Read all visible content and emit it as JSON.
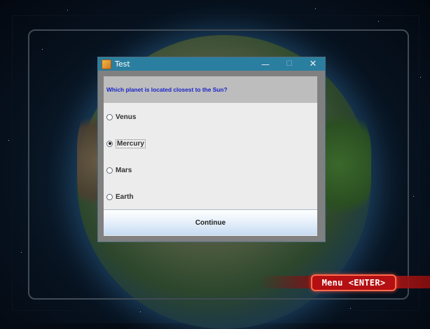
{
  "window": {
    "title": "Test",
    "controls": {
      "minimize": "—",
      "maximize": "☐",
      "close": "✕"
    }
  },
  "quiz": {
    "question": "Which planet is located closest to the Sun?",
    "options": [
      {
        "label": "Venus",
        "selected": false
      },
      {
        "label": "Mercury",
        "selected": true
      },
      {
        "label": "Mars",
        "selected": false
      },
      {
        "label": "Earth",
        "selected": false
      }
    ],
    "continue_label": "Continue"
  },
  "game": {
    "menu_label": "Menu",
    "menu_key": "<ENTER>"
  },
  "colors": {
    "titlebar": "#2a7e9f",
    "question_text": "#1a24c9",
    "menu_button": "#b40f12"
  },
  "icons": {
    "app_icon": "java-cup-icon",
    "minimize": "minimize-icon",
    "maximize": "maximize-icon",
    "close": "close-icon"
  }
}
